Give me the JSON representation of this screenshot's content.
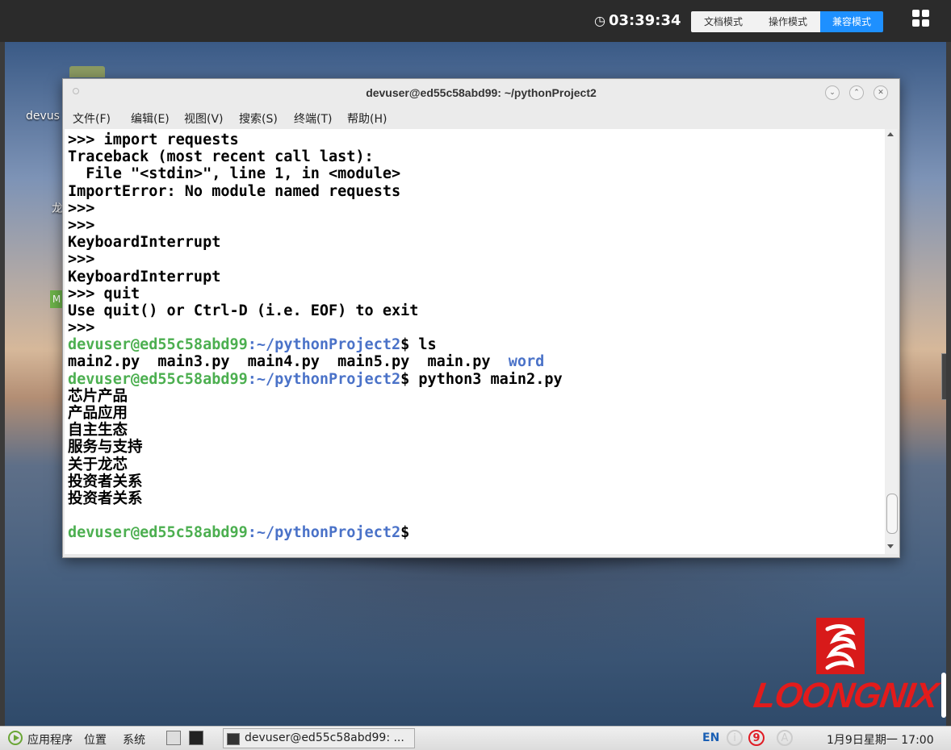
{
  "topbar": {
    "time": "03:39:34",
    "modes": [
      "文档模式",
      "操作模式",
      "兼容模式"
    ],
    "active_mode": "兼容模式"
  },
  "desktop": {
    "icon_label_1": "devus",
    "icon_label_2": "龙",
    "badge": "M"
  },
  "terminal": {
    "title": "devuser@ed55c58abd99: ~/pythonProject2",
    "menus": [
      "文件(F)",
      "编辑(E)",
      "视图(V)",
      "搜索(S)",
      "终端(T)",
      "帮助(H)"
    ],
    "prompt_user": "devuser@ed55c58abd99",
    "prompt_path": ":~/pythonProject2",
    "prompt_symbol": "$",
    "lines": [
      ">>> import requests",
      "Traceback (most recent call last):",
      "  File \"<stdin>\", line 1, in <module>",
      "ImportError: No module named requests",
      ">>>",
      ">>>",
      "KeyboardInterrupt",
      ">>>",
      "KeyboardInterrupt",
      ">>> quit",
      "Use quit() or Ctrl-D (i.e. EOF) to exit",
      ">>>"
    ],
    "cmd_ls": " ls",
    "ls_files": "main2.py  main3.py  main4.py  main5.py  main.py  ",
    "ls_dir": "word",
    "cmd_run": " python3 main2.py",
    "output": [
      "芯片产品",
      "产品应用",
      "自主生态",
      "服务与支持",
      "关于龙芯",
      "投资者关系",
      "投资者关系"
    ]
  },
  "brand": {
    "logo_text": "LOONGNIX"
  },
  "taskbar": {
    "apps": "应用程序",
    "places": "位置",
    "system": "系统",
    "window_label": "devuser@ed55c58abd99: ...",
    "lang": "EN",
    "tray_i": "i",
    "tray_9": "9",
    "tray_a": "A",
    "datetime": "1月9日星期一 17:00"
  },
  "colors": {
    "prompt_user": "#4caf50",
    "prompt_path": "#4a72c8",
    "active_mode": "#1e90ff",
    "brand_red": "#e31b1b"
  }
}
